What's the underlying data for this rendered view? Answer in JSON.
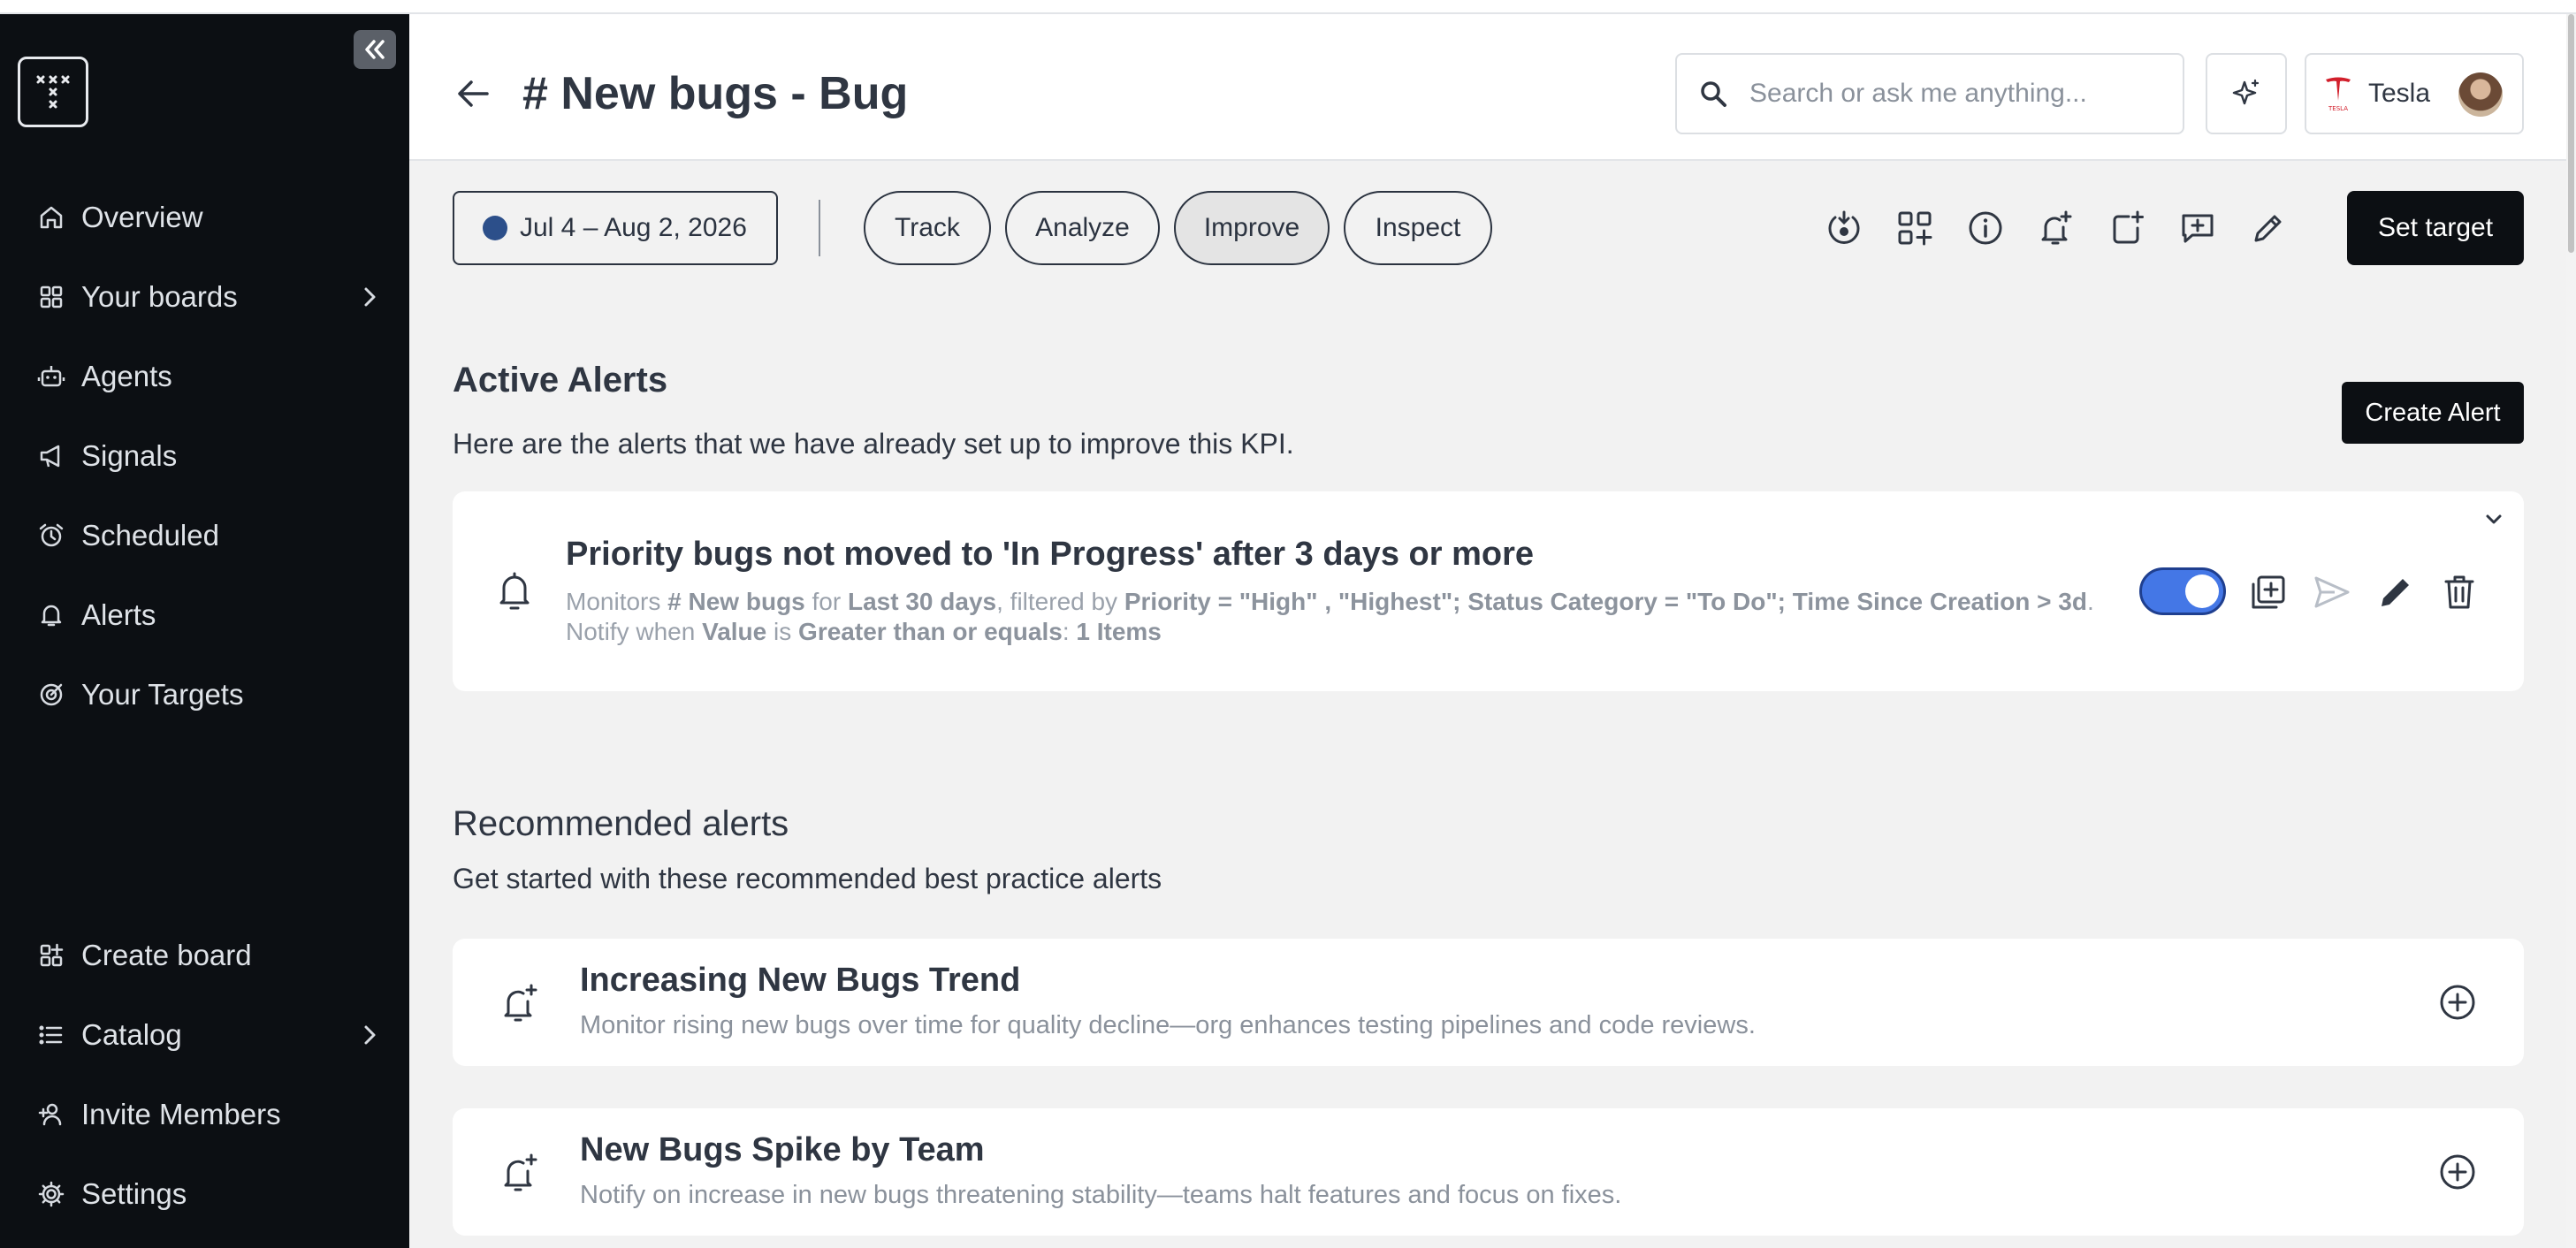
{
  "sidebar": {
    "nav_items": [
      {
        "label": "Overview",
        "icon": "home-icon"
      },
      {
        "label": "Your boards",
        "icon": "grid-icon"
      },
      {
        "label": "Agents",
        "icon": "robot-icon"
      },
      {
        "label": "Signals",
        "icon": "megaphone-icon"
      },
      {
        "label": "Scheduled",
        "icon": "alarm-clock-icon"
      },
      {
        "label": "Alerts",
        "icon": "bell-icon"
      },
      {
        "label": "Your Targets",
        "icon": "target-icon"
      }
    ],
    "bottom_items": [
      {
        "label": "Create board",
        "icon": "add-grid-icon"
      },
      {
        "label": "Catalog",
        "icon": "list-icon"
      },
      {
        "label": "Invite Members",
        "icon": "add-user-icon"
      },
      {
        "label": "Settings",
        "icon": "gear-icon"
      }
    ]
  },
  "header": {
    "title": "# New bugs - Bug",
    "search_placeholder": "Search or ask me anything...",
    "account_name": "Tesla"
  },
  "toolbar": {
    "date_range": "Jul 4 – Aug 2, 2026",
    "tabs": [
      "Track",
      "Analyze",
      "Improve",
      "Inspect"
    ],
    "active_tab": "Improve",
    "set_target_label": "Set target",
    "date_dot_color": "#2c4f8a"
  },
  "active_alerts": {
    "title": "Active Alerts",
    "subtitle": "Here are the alerts that we have already set up to improve this KPI.",
    "create_label": "Create Alert",
    "alert": {
      "title": "Priority bugs not moved to 'In Progress' after 3 days or more",
      "monitors": "Monitors",
      "metric": "# New bugs",
      "for": "for",
      "period": "Last 30 days",
      "filtered_by": ", filtered by",
      "filter": "Priority = \"High\" , \"Highest\"; Status Category = \"To Do\"; Time Since Creation > 3d",
      "notify_when": ". Notify when",
      "field": "Value",
      "is": "is",
      "operator": "Greater than or equals",
      "colon": ":",
      "threshold": "1 Items",
      "enabled": true
    }
  },
  "recommended": {
    "title": "Recommended alerts",
    "subtitle": "Get started with these recommended best practice alerts",
    "items": [
      {
        "title": "Increasing New Bugs Trend",
        "description": "Monitor rising new bugs over time for quality decline—org enhances testing pipelines and code reviews."
      },
      {
        "title": "New Bugs Spike by Team",
        "description": "Notify on increase in new bugs threatening stability—teams halt features and focus on fixes."
      }
    ]
  },
  "colors": {
    "sidebar_bg": "#0c0f13",
    "accent_toggle": "#4477e6",
    "primary_button": "#0c0f13"
  }
}
